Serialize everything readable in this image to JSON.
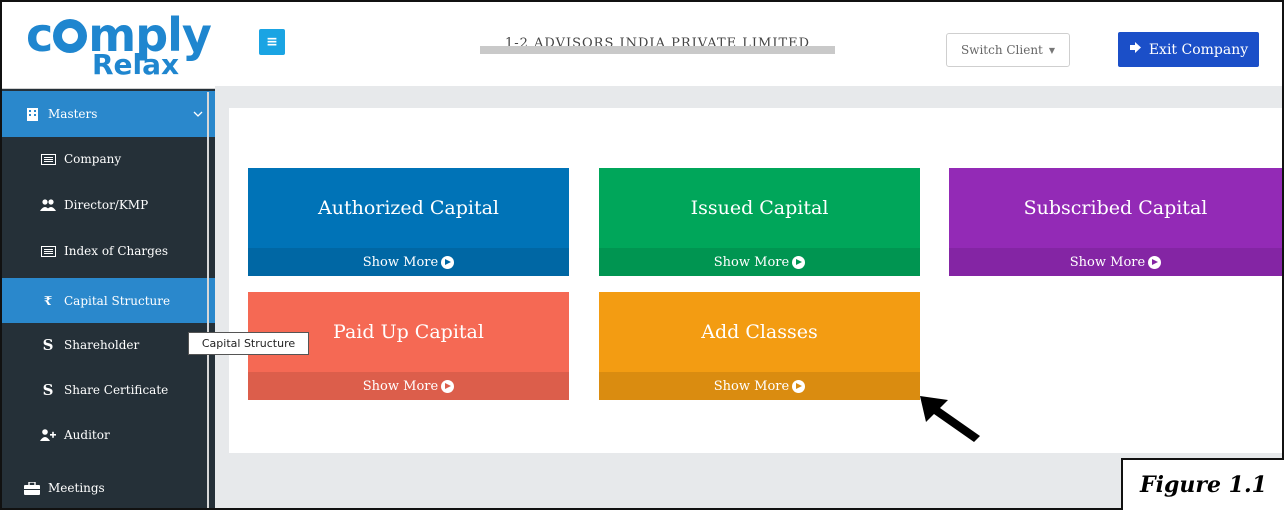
{
  "logo": {
    "main_before": "c",
    "main_after": "mply",
    "sub": "Relax"
  },
  "sidebar": {
    "items": [
      {
        "label": "Masters",
        "icon": "building-icon"
      },
      {
        "label": "Company",
        "icon": "list-icon"
      },
      {
        "label": "Director/KMP",
        "icon": "users-icon"
      },
      {
        "label": "Index of Charges",
        "icon": "list-icon"
      },
      {
        "label": "Capital Structure",
        "icon": "rupee-icon",
        "glyph": "₹"
      },
      {
        "label": "Shareholder",
        "icon": "s-icon",
        "glyph": "S"
      },
      {
        "label": "Share Certificate",
        "icon": "s-icon",
        "glyph": "S"
      },
      {
        "label": "Auditor",
        "icon": "user-plus-icon"
      },
      {
        "label": "Meetings",
        "icon": "briefcase-icon"
      }
    ]
  },
  "tooltip": {
    "text": "Capital Structure"
  },
  "header": {
    "menu_glyph": "≡",
    "company_name": "1-2 ADVISORS INDIA PRIVATE LIMITED",
    "switch_client_label": "Switch Client",
    "exit_label": "Exit Company"
  },
  "tiles": [
    {
      "title": "Authorized Capital",
      "action": "Show More"
    },
    {
      "title": "Issued Capital",
      "action": "Show More"
    },
    {
      "title": "Subscribed Capital",
      "action": "Show More"
    },
    {
      "title": "Paid Up Capital",
      "action": "Show More"
    },
    {
      "title": "Add Classes",
      "action": "Show More"
    }
  ],
  "caption": "Figure 1.1",
  "colors": {
    "sidebar_bg": "#253038",
    "sidebar_active": "#2a88cc",
    "authorized": "#0073b7",
    "issued": "#00a65a",
    "subscribed": "#932ab6",
    "paid_up": "#f56954",
    "add_classes": "#f39c12",
    "exit_button": "#1b4fc8"
  }
}
